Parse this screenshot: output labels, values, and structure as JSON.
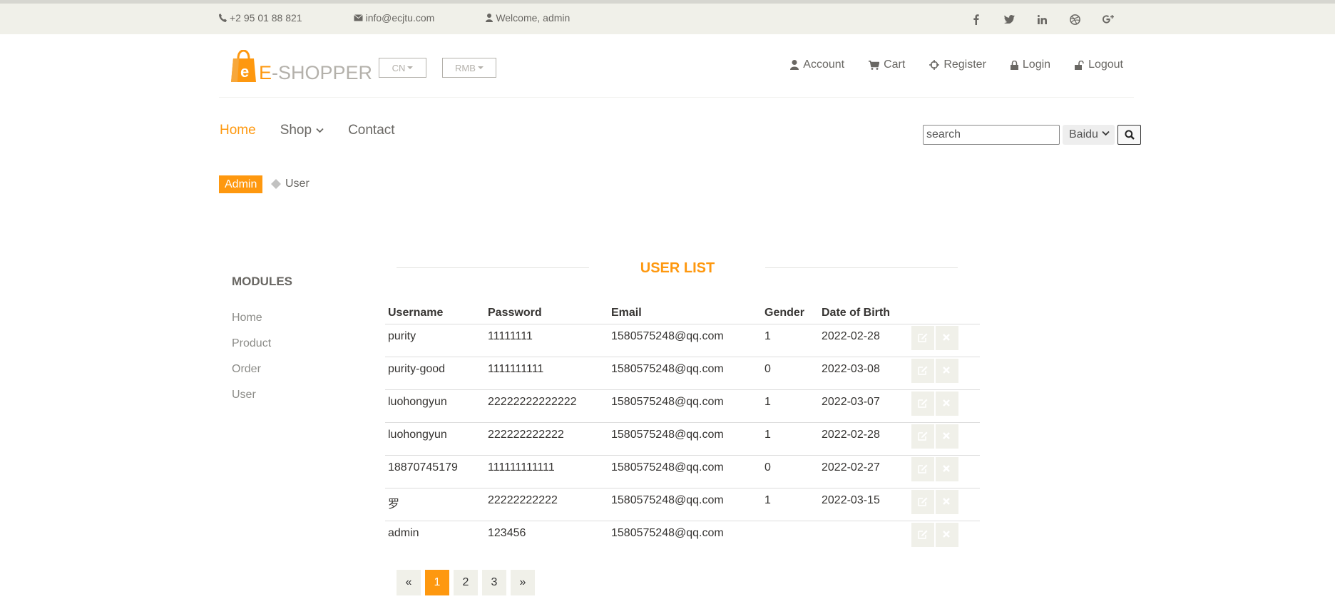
{
  "header": {
    "phone": "+2 95 01 88 821",
    "email": "info@ecjtu.com",
    "welcome": "Welcome, admin",
    "social": [
      "facebook-icon",
      "twitter-icon",
      "linkedin-icon",
      "dribbble-icon",
      "google-plus-icon"
    ]
  },
  "brand": {
    "logo_letter": "e",
    "logo_e": "E",
    "logo_rest": "-SHOPPER",
    "accent": "#fe980f"
  },
  "selectors": {
    "language": "CN",
    "currency": "RMB"
  },
  "account_nav": {
    "account": "Account",
    "cart": "Cart",
    "register": "Register",
    "login": "Login",
    "logout": "Logout"
  },
  "nav": {
    "home": "Home",
    "shop": "Shop",
    "contact": "Contact"
  },
  "search": {
    "placeholder": "search",
    "engine": "Baidu"
  },
  "breadcrumb": {
    "parent": "Admin",
    "current": "User"
  },
  "sidebar": {
    "title": "MODULES",
    "items": [
      "Home",
      "Product",
      "Order",
      "User"
    ]
  },
  "main": {
    "title": "USER LIST",
    "columns": [
      "Username",
      "Password",
      "Email",
      "Gender",
      "Date of Birth"
    ],
    "rows": [
      [
        "purity",
        "11111111",
        "1580575248@qq.com",
        "1",
        "2022-02-28"
      ],
      [
        "purity-good",
        "1111111111",
        "1580575248@qq.com",
        "0",
        "2022-03-08"
      ],
      [
        "luohongyun",
        "22222222222222",
        "1580575248@qq.com",
        "1",
        "2022-03-07"
      ],
      [
        "luohongyun",
        "222222222222",
        "1580575248@qq.com",
        "1",
        "2022-02-28"
      ],
      [
        "18870745179",
        "111111111111",
        "1580575248@qq.com",
        "0",
        "2022-02-27"
      ],
      [
        "罗",
        "22222222222",
        "1580575248@qq.com",
        "1",
        "2022-03-15"
      ],
      [
        "admin",
        "123456",
        "1580575248@qq.com",
        "",
        ""
      ]
    ]
  },
  "pagination": {
    "prev": "«",
    "pages": [
      "1",
      "2",
      "3"
    ],
    "current": "1",
    "next": "»"
  }
}
